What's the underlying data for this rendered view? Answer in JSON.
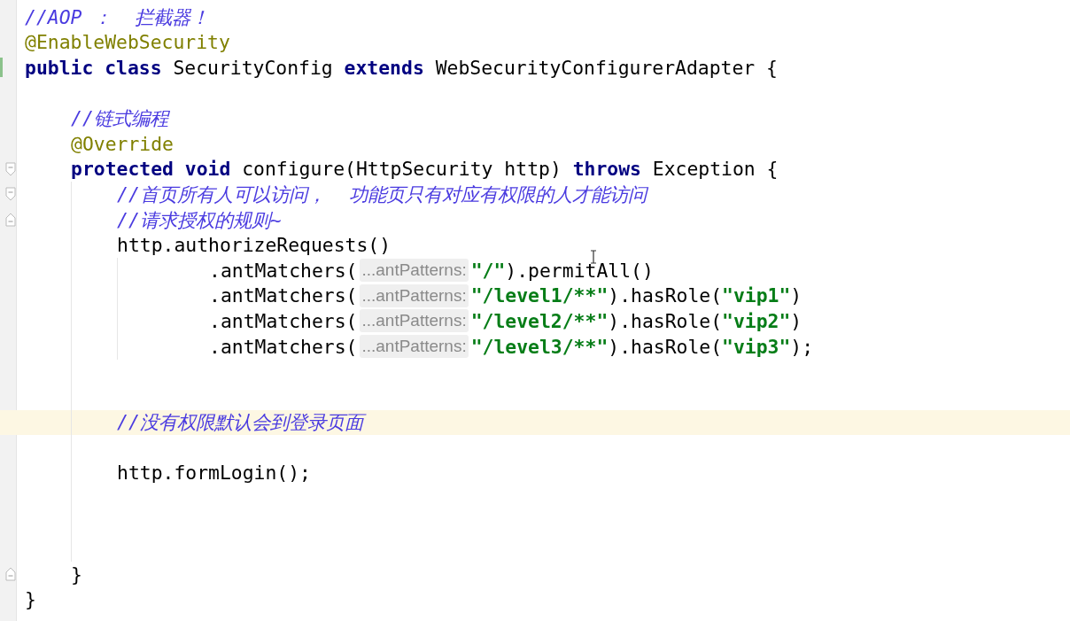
{
  "editor": {
    "lines": [
      {
        "tokens": [
          {
            "kind": "comment",
            "text": "//AOP ：  拦截器！"
          }
        ]
      },
      {
        "tokens": [
          {
            "kind": "annotation",
            "text": "@EnableWebSecurity"
          }
        ]
      },
      {
        "changed": true,
        "tokens": [
          {
            "kind": "keyword",
            "text": "public class"
          },
          {
            "kind": "plain",
            "text": " SecurityConfig "
          },
          {
            "kind": "keyword",
            "text": "extends"
          },
          {
            "kind": "plain",
            "text": " WebSecurityConfigurerAdapter {"
          }
        ]
      },
      {
        "kind": "blank"
      },
      {
        "tokens": [
          {
            "kind": "comment",
            "text": "    //链式编程"
          }
        ]
      },
      {
        "tokens": [
          {
            "kind": "annotation",
            "text": "    @Override"
          }
        ]
      },
      {
        "fold_start": true,
        "tokens": [
          {
            "kind": "keyword",
            "text": "    protected void"
          },
          {
            "kind": "plain",
            "text": " configure(HttpSecurity http) "
          },
          {
            "kind": "keyword",
            "text": "throws"
          },
          {
            "kind": "plain",
            "text": " Exception {"
          }
        ]
      },
      {
        "fold_start": true,
        "tokens": [
          {
            "kind": "comment",
            "text": "        //首页所有人可以访问，  功能页只有对应有权限的人才能访问"
          }
        ]
      },
      {
        "fold_end": true,
        "tokens": [
          {
            "kind": "comment",
            "text": "        //请求授权的规则~"
          }
        ]
      },
      {
        "tokens": [
          {
            "kind": "plain",
            "text": "        http.authorizeRequests()"
          }
        ]
      },
      {
        "tokens": [
          {
            "kind": "plain",
            "text": "                .antMatchers("
          },
          {
            "kind": "hint",
            "text": "...antPatterns:"
          },
          {
            "kind": "string",
            "text": "\"/\""
          },
          {
            "kind": "plain",
            "text": ").permitAll()"
          }
        ]
      },
      {
        "tokens": [
          {
            "kind": "plain",
            "text": "                .antMatchers("
          },
          {
            "kind": "hint",
            "text": "...antPatterns:"
          },
          {
            "kind": "string",
            "text": "\"/level1/**\""
          },
          {
            "kind": "plain",
            "text": ").hasRole("
          },
          {
            "kind": "string",
            "text": "\"vip1\""
          },
          {
            "kind": "plain",
            "text": ")"
          }
        ]
      },
      {
        "tokens": [
          {
            "kind": "plain",
            "text": "                .antMatchers("
          },
          {
            "kind": "hint",
            "text": "...antPatterns:"
          },
          {
            "kind": "string",
            "text": "\"/level2/**\""
          },
          {
            "kind": "plain",
            "text": ").hasRole("
          },
          {
            "kind": "string",
            "text": "\"vip2\""
          },
          {
            "kind": "plain",
            "text": ")"
          }
        ]
      },
      {
        "tokens": [
          {
            "kind": "plain",
            "text": "                .antMatchers("
          },
          {
            "kind": "hint",
            "text": "...antPatterns:"
          },
          {
            "kind": "string",
            "text": "\"/level3/**\""
          },
          {
            "kind": "plain",
            "text": ").hasRole("
          },
          {
            "kind": "string",
            "text": "\"vip3\""
          },
          {
            "kind": "plain",
            "text": ");"
          }
        ]
      },
      {
        "kind": "blank"
      },
      {
        "kind": "blank"
      },
      {
        "current": true,
        "tokens": [
          {
            "kind": "comment",
            "text": "        //没有权限默认会到登录页面"
          }
        ]
      },
      {
        "kind": "blank"
      },
      {
        "tokens": [
          {
            "kind": "plain",
            "text": "        http.formLogin();"
          }
        ]
      },
      {
        "kind": "blank"
      },
      {
        "kind": "blank"
      },
      {
        "kind": "blank"
      },
      {
        "fold_end": true,
        "tokens": [
          {
            "kind": "plain",
            "text": "    }"
          }
        ]
      },
      {
        "tokens": [
          {
            "kind": "plain",
            "text": "}"
          }
        ]
      }
    ]
  }
}
